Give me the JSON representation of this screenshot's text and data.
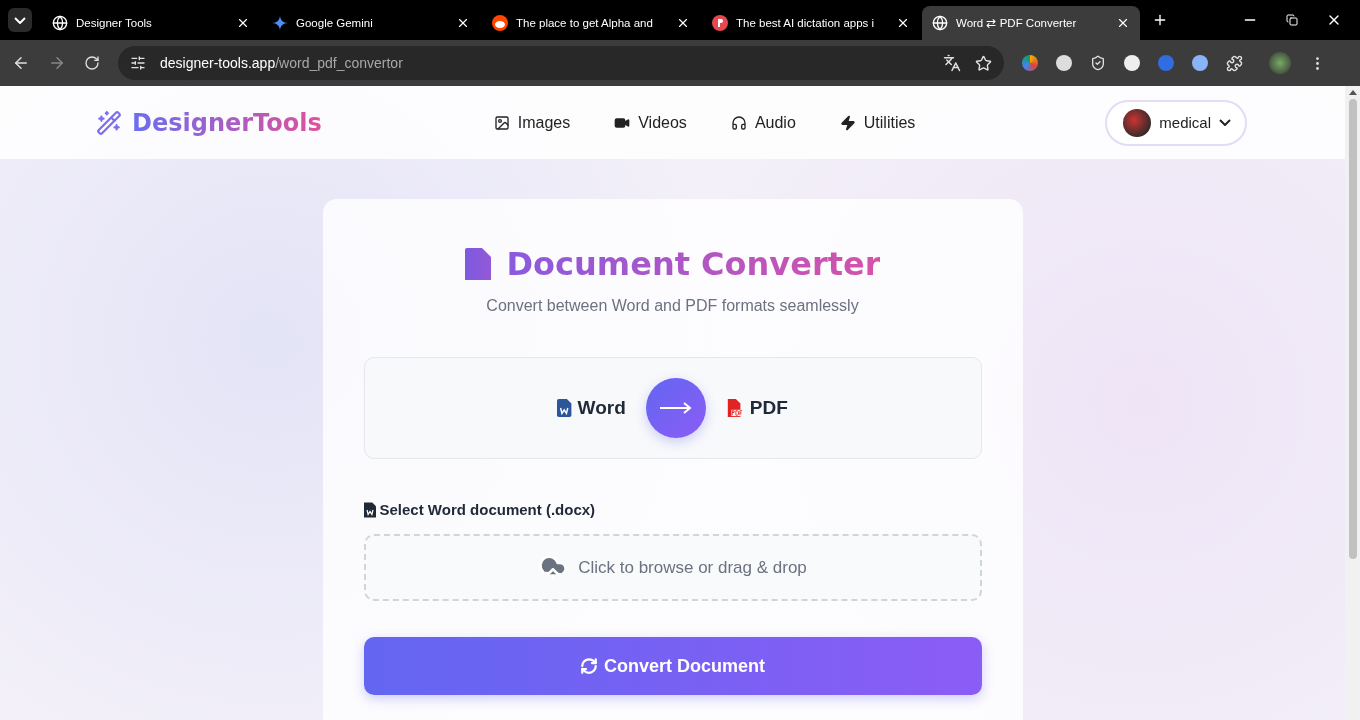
{
  "browser": {
    "tabs": [
      {
        "title": "Designer Tools",
        "selected": false
      },
      {
        "title": "Google Gemini",
        "selected": false
      },
      {
        "title": "The place to get Alpha and",
        "selected": false
      },
      {
        "title": "The best AI dictation apps i",
        "selected": false
      },
      {
        "title": "Word ⇄ PDF Converter",
        "selected": true
      }
    ],
    "address": {
      "host": "designer-tools.app",
      "path": "/word_pdf_convertor"
    }
  },
  "header": {
    "logo": "DesignerTools",
    "nav": [
      {
        "label": "Images"
      },
      {
        "label": "Videos"
      },
      {
        "label": "Audio"
      },
      {
        "label": "Utilities"
      }
    ],
    "user": {
      "name": "medical"
    }
  },
  "converter": {
    "title": "Document Converter",
    "subtitle": "Convert between Word and PDF formats seamlessly",
    "from": {
      "label": "Word",
      "kind": "word"
    },
    "to": {
      "label": "PDF",
      "kind": "pdf"
    },
    "file_label": "Select Word document (.docx)",
    "dropzone": "Click to browse or drag & drop",
    "button": "Convert Document"
  }
}
